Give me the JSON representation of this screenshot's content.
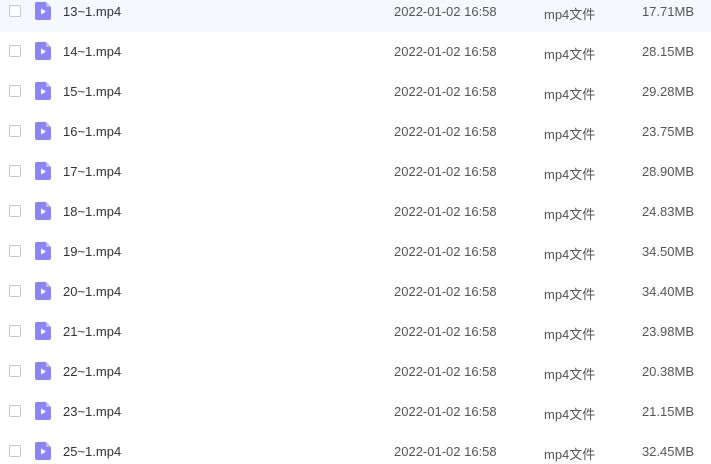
{
  "file_list": {
    "icon": "video-file-icon",
    "icon_color": "#8b85f5",
    "rows": [
      {
        "name": "13~1.mp4",
        "date": "2022-01-02 16:58",
        "type": "mp4文件",
        "size": "17.71MB"
      },
      {
        "name": "14~1.mp4",
        "date": "2022-01-02 16:58",
        "type": "mp4文件",
        "size": "28.15MB"
      },
      {
        "name": "15~1.mp4",
        "date": "2022-01-02 16:58",
        "type": "mp4文件",
        "size": "29.28MB"
      },
      {
        "name": "16~1.mp4",
        "date": "2022-01-02 16:58",
        "type": "mp4文件",
        "size": "23.75MB"
      },
      {
        "name": "17~1.mp4",
        "date": "2022-01-02 16:58",
        "type": "mp4文件",
        "size": "28.90MB"
      },
      {
        "name": "18~1.mp4",
        "date": "2022-01-02 16:58",
        "type": "mp4文件",
        "size": "24.83MB"
      },
      {
        "name": "19~1.mp4",
        "date": "2022-01-02 16:58",
        "type": "mp4文件",
        "size": "34.50MB"
      },
      {
        "name": "20~1.mp4",
        "date": "2022-01-02 16:58",
        "type": "mp4文件",
        "size": "34.40MB"
      },
      {
        "name": "21~1.mp4",
        "date": "2022-01-02 16:58",
        "type": "mp4文件",
        "size": "23.98MB"
      },
      {
        "name": "22~1.mp4",
        "date": "2022-01-02 16:58",
        "type": "mp4文件",
        "size": "20.38MB"
      },
      {
        "name": "23~1.mp4",
        "date": "2022-01-02 16:58",
        "type": "mp4文件",
        "size": "21.15MB"
      },
      {
        "name": "25~1.mp4",
        "date": "2022-01-02 16:58",
        "type": "mp4文件",
        "size": "32.45MB"
      }
    ]
  }
}
